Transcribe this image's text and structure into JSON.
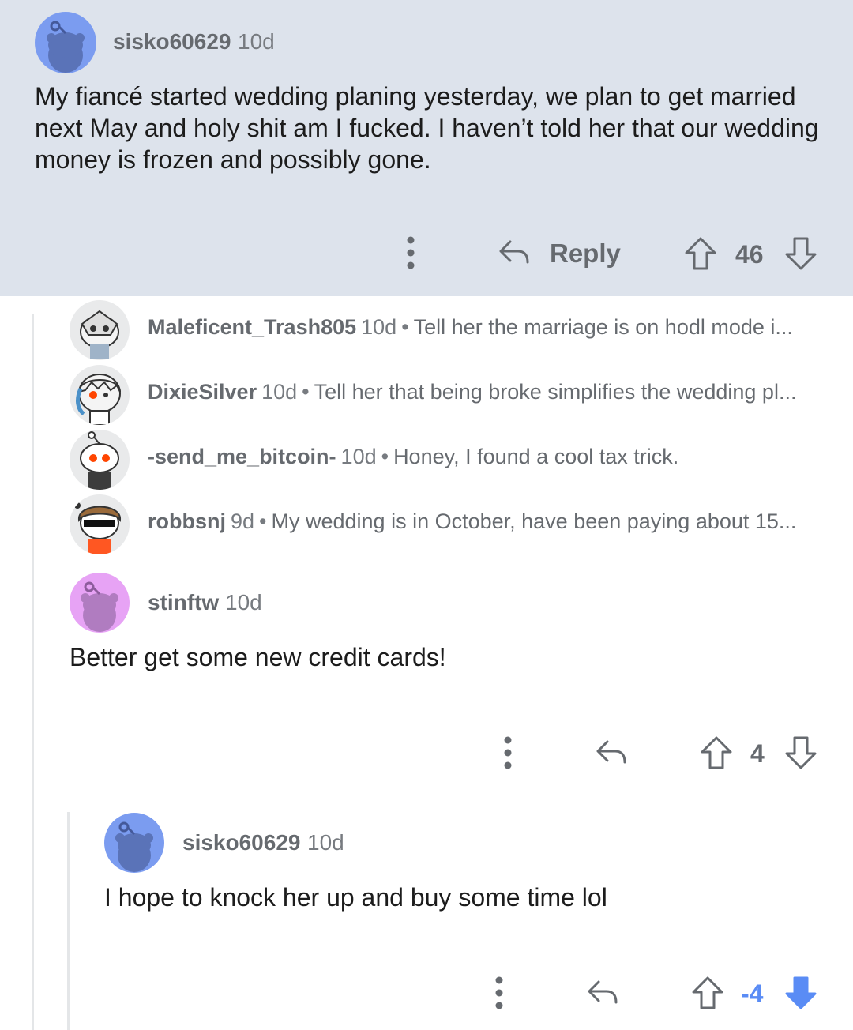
{
  "comment_main": {
    "username": "sisko60629",
    "age": "10d",
    "text": "My fiancé started wedding planing yesterday, we plan to get married next May and holy shit am I fucked. I haven’t told her that our wedding money is frozen and possibly gone.",
    "reply_label": "Reply",
    "vote_count": "46",
    "icons": [
      "more-options-icon",
      "reply-icon",
      "upvote-icon",
      "downvote-icon"
    ]
  },
  "collapsed_replies": [
    {
      "username": "Maleficent_Trash805",
      "age": "10d",
      "snippet": "Tell her the marriage is on hodl mode i..."
    },
    {
      "username": "DixieSilver",
      "age": "10d",
      "snippet": "Tell her that being broke simplifies the wedding pl..."
    },
    {
      "username": "-send_me_bitcoin-",
      "age": "10d",
      "snippet": "Honey, I found a cool tax trick."
    },
    {
      "username": "robbsnj",
      "age": "9d",
      "snippet": "My wedding is in October, have been paying about 15..."
    }
  ],
  "separator": "•",
  "comment_stinftw": {
    "username": "stinftw",
    "age": "10d",
    "text": "Better get some new credit cards!",
    "vote_count": "4"
  },
  "comment_reply": {
    "username": "sisko60629",
    "age": "10d",
    "text": "I hope to knock her up and buy some time lol",
    "vote_count": "-4",
    "downvote_active": true
  },
  "colors": {
    "highlight_bg": "#dde3ec",
    "avatar_blue": "#7b9cf0",
    "avatar_purple": "#e7a3f5",
    "downvote_active": "#5a8cf5",
    "meta_gray": "#666a6f"
  }
}
